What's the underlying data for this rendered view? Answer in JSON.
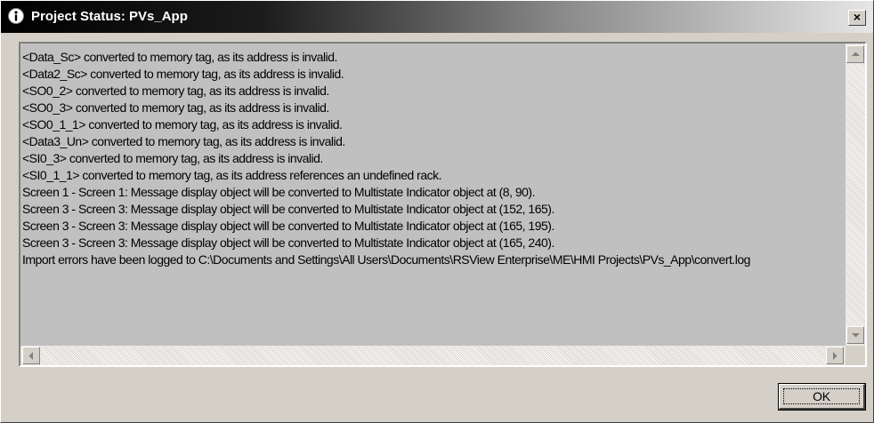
{
  "window": {
    "title": "Project Status: PVs_App",
    "close_glyph": "×",
    "info_icon": "info-icon"
  },
  "log": {
    "lines": [
      "<Data_Sc> converted to memory tag, as its address is invalid.",
      "<Data2_Sc> converted to memory tag, as its address is invalid.",
      "<SO0_2> converted to memory tag, as its address is invalid.",
      "<SO0_3> converted to memory tag, as its address is invalid.",
      "<SO0_1_1> converted to memory tag, as its address is invalid.",
      "<Data3_Un> converted to memory tag, as its address is invalid.",
      "<SI0_3> converted to memory tag, as its address is invalid.",
      "<SI0_1_1> converted to memory tag, as its address references an undefined rack.",
      "Screen 1 - Screen 1: Message display object will be converted to Multistate Indicator object at (8, 90).",
      "Screen 3 - Screen 3: Message display object will be converted to Multistate Indicator object at (152, 165).",
      "Screen 3 - Screen 3: Message display object will be converted to Multistate Indicator object at (165, 195).",
      "Screen 3 - Screen 3: Message display object will be converted to Multistate Indicator object at (165, 240).",
      "Import errors have been logged to C:\\Documents and Settings\\All Users\\Documents\\RSView Enterprise\\ME\\HMI Projects\\PVs_App\\convert.log"
    ]
  },
  "buttons": {
    "ok_label": "OK"
  },
  "colors": {
    "face": "#d4d0c8",
    "title_start": "#000000",
    "title_end": "#e6e6e6"
  }
}
